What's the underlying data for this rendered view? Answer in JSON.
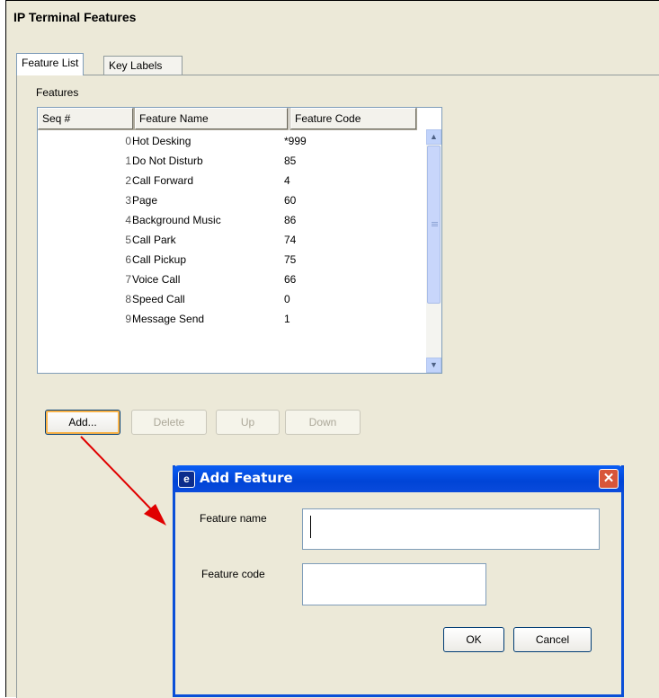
{
  "window": {
    "title": "IP Terminal Features"
  },
  "tabs": [
    {
      "label": "Feature List"
    },
    {
      "label": "Key Labels"
    }
  ],
  "features": {
    "group_label": "Features",
    "columns": [
      "Seq #",
      "Feature Name",
      "Feature Code"
    ],
    "rows": [
      {
        "seq": "0",
        "name": "Hot Desking",
        "code": "*999"
      },
      {
        "seq": "1",
        "name": "Do Not Disturb",
        "code": "85"
      },
      {
        "seq": "2",
        "name": "Call Forward",
        "code": "4"
      },
      {
        "seq": "3",
        "name": "Page",
        "code": "60"
      },
      {
        "seq": "4",
        "name": "Background Music",
        "code": "86"
      },
      {
        "seq": "5",
        "name": "Call Park",
        "code": "74"
      },
      {
        "seq": "6",
        "name": "Call Pickup",
        "code": "75"
      },
      {
        "seq": "7",
        "name": "Voice Call",
        "code": "66"
      },
      {
        "seq": "8",
        "name": "Speed Call",
        "code": "0"
      },
      {
        "seq": "9",
        "name": "Message Send",
        "code": "1"
      }
    ]
  },
  "buttons": {
    "add": "Add...",
    "delete": "Delete",
    "up": "Up",
    "down": "Down"
  },
  "dialog": {
    "title": "Add Feature",
    "name_label": "Feature name",
    "name_value": "",
    "code_label": "Feature code",
    "code_value": "",
    "ok": "OK",
    "cancel": "Cancel"
  },
  "colors": {
    "dialog_title": "#0a4fd8",
    "close_button": "#d8553a",
    "arrow": "#e00000"
  }
}
